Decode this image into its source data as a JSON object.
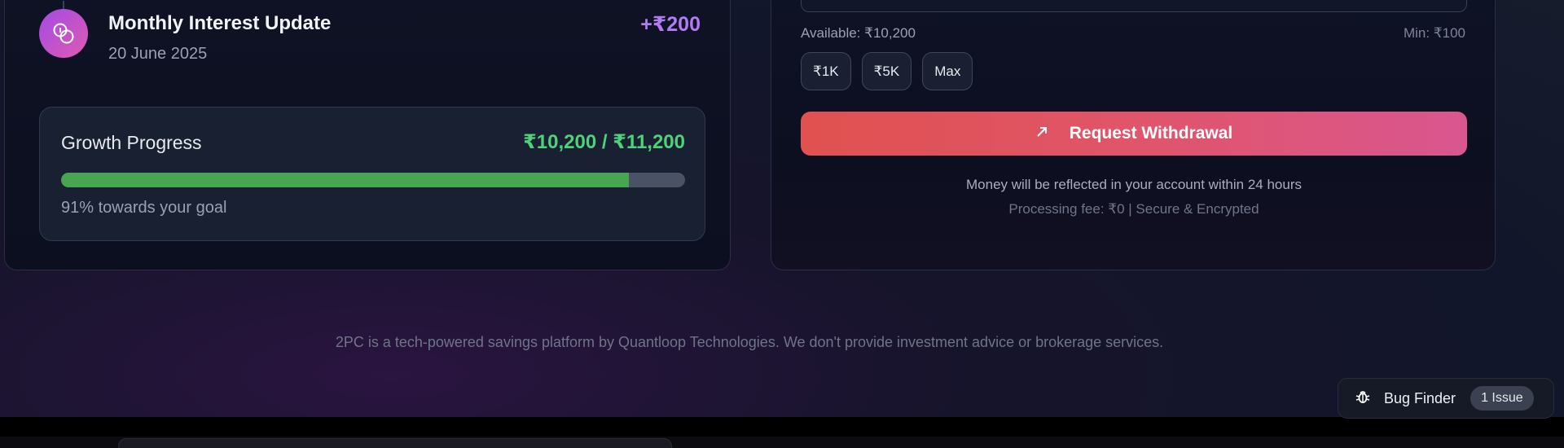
{
  "transaction": {
    "title": "Monthly Interest Update",
    "date": "20 June 2025",
    "amount": "+₹200",
    "icon": "coins-icon"
  },
  "growth": {
    "title": "Growth Progress",
    "value_text": "₹10,200 / ₹11,200",
    "progress_percent": 91,
    "caption": "91% towards your goal"
  },
  "withdraw": {
    "available": "Available: ₹10,200",
    "min": "Min: ₹100",
    "chips": [
      "₹1K",
      "₹5K",
      "Max"
    ],
    "button_label": "Request Withdrawal",
    "button_icon": "arrow-up-right-icon",
    "note": "Money will be reflected in your account within 24 hours",
    "fee_note": "Processing fee: ₹0 | Secure & Encrypted"
  },
  "footer": {
    "text": "2PC is a tech-powered savings platform by Quantloop Technologies. We don't provide investment advice or brokerage services."
  },
  "bug_finder": {
    "label": "Bug Finder",
    "badge": "1 Issue",
    "icon": "bug-icon"
  },
  "colors": {
    "accent_purple": "#b07cf3",
    "success_green": "#4fd17a",
    "progress_fill": "#48a653",
    "button_start": "#e0514f",
    "button_end": "#d9568f"
  }
}
